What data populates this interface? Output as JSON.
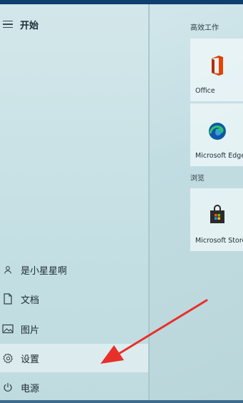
{
  "start": {
    "title": "开始"
  },
  "menu": {
    "user": {
      "label": "是小星星啊",
      "icon": "user-icon"
    },
    "documents": {
      "label": "文档",
      "icon": "document-icon"
    },
    "pictures": {
      "label": "图片",
      "icon": "picture-icon"
    },
    "settings": {
      "label": "设置",
      "icon": "gear-icon",
      "highlighted": true
    },
    "power": {
      "label": "电源",
      "icon": "power-icon"
    }
  },
  "tiles": {
    "groups": [
      {
        "label": "高效工作",
        "items": [
          "Office",
          "Microsoft Edge"
        ]
      },
      {
        "label": "浏览",
        "items": [
          "Microsoft Store"
        ]
      }
    ],
    "office_label": "Office",
    "edge_label": "Microsoft Edge",
    "store_label": "Microsoft Store"
  },
  "annotation": {
    "type": "red-arrow",
    "points_to": "settings",
    "color": "#e8302a"
  },
  "colors": {
    "office": "#d83b01",
    "edge_blue": "#0c59a4",
    "edge_green": "#32c36b",
    "arrow": "#e8302a"
  }
}
